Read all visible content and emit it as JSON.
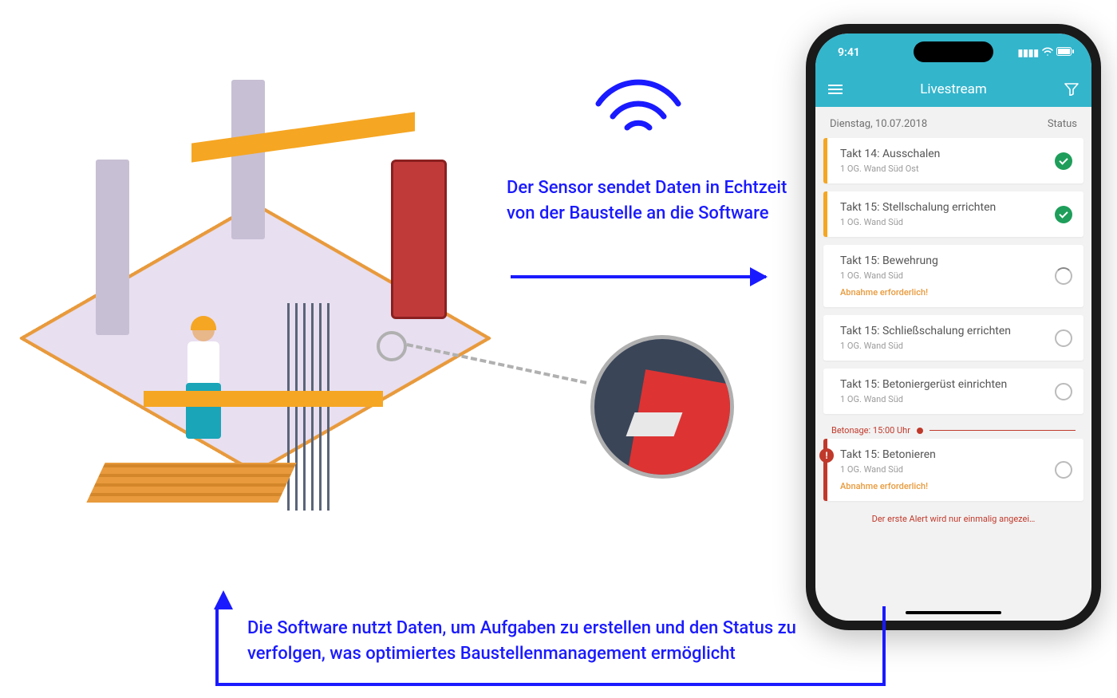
{
  "annotations": {
    "sensor_sends": "Der Sensor sendet Daten in Echtzeit von der Baustelle an die Software",
    "software_uses": "Die Software nutzt Daten, um Aufgaben zu erstellen und den Status zu verfolgen, was optimiertes Baustellenmanagement ermöglicht"
  },
  "phone": {
    "status_bar": {
      "time": "9:41"
    },
    "app_header": {
      "title": "Livestream"
    },
    "date_row": {
      "date": "Dienstag, 10.07.2018",
      "status_label": "Status"
    },
    "divider": {
      "label": "Betonage: 15:00 Uhr"
    },
    "truncated_hint": "Der erste Alert wird nur einmalig angezei…",
    "tasks": [
      {
        "title": "Takt 14: Ausschalen",
        "sub": "1 OG. Wand Süd Ost",
        "status": "done",
        "accent": "orange"
      },
      {
        "title": "Takt 15: Stellschalung errichten",
        "sub": "1 OG. Wand Süd",
        "status": "done",
        "accent": "orange"
      },
      {
        "title": "Takt 15: Bewehrung",
        "sub": "1 OG. Wand Süd",
        "status": "loading",
        "accent": "neutral",
        "note": "Abnahme erforderlich!"
      },
      {
        "title": "Takt 15: Schließschalung errichten",
        "sub": "1 OG. Wand Süd",
        "status": "pending",
        "accent": "neutral"
      },
      {
        "title": "Takt 15: Betoniergerüst einrichten",
        "sub": "1 OG. Wand Süd",
        "status": "pending",
        "accent": "neutral"
      },
      {
        "title": "Takt 15: Betonieren",
        "sub": "1 OG. Wand Süd",
        "status": "pending",
        "accent": "alert",
        "note": "Abnahme erforderlich!",
        "alert_badge": "!"
      }
    ]
  }
}
